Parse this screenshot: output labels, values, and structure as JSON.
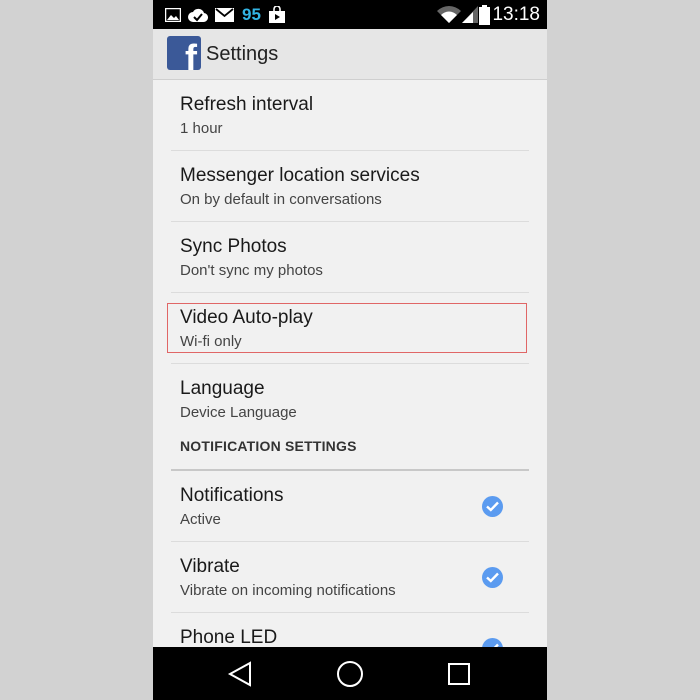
{
  "status_bar": {
    "icons": [
      "image-icon",
      "checkmark-cloud-icon",
      "email-icon",
      "battery-percent",
      "shopping-bag-icon",
      "wifi-icon",
      "signal-icon",
      "battery-icon"
    ],
    "battery_percent": "95",
    "time": "13:18"
  },
  "action_bar": {
    "logo_icon": "facebook-logo",
    "logo_letter": "f",
    "title": "Settings"
  },
  "preferences": [
    {
      "title": "Refresh interval",
      "summary": "1 hour"
    },
    {
      "title": "Messenger location services",
      "summary": "On by default in conversations"
    },
    {
      "title": "Sync Photos",
      "summary": "Don't sync my photos"
    },
    {
      "title": "Video Auto-play",
      "summary": "Wi-fi only"
    },
    {
      "title": "Language",
      "summary": "Device Language"
    }
  ],
  "notification_category": "NOTIFICATION SETTINGS",
  "notification_prefs": [
    {
      "title": "Notifications",
      "summary": "Active",
      "checked": true
    },
    {
      "title": "Vibrate",
      "summary": "Vibrate on incoming notifications",
      "checked": true
    },
    {
      "title": "Phone LED",
      "summary": "",
      "checked": true
    }
  ],
  "nav_bar": {
    "back_icon": "back-triangle-icon",
    "home_icon": "home-circle-icon",
    "recents_icon": "recents-square-icon"
  },
  "colors": {
    "status_bar": "#000000",
    "battery_percent": "#33b5e5",
    "facebook_blue": "#3b5998",
    "check_blue": "#5b9bf0",
    "highlight_border": "#e06666"
  }
}
